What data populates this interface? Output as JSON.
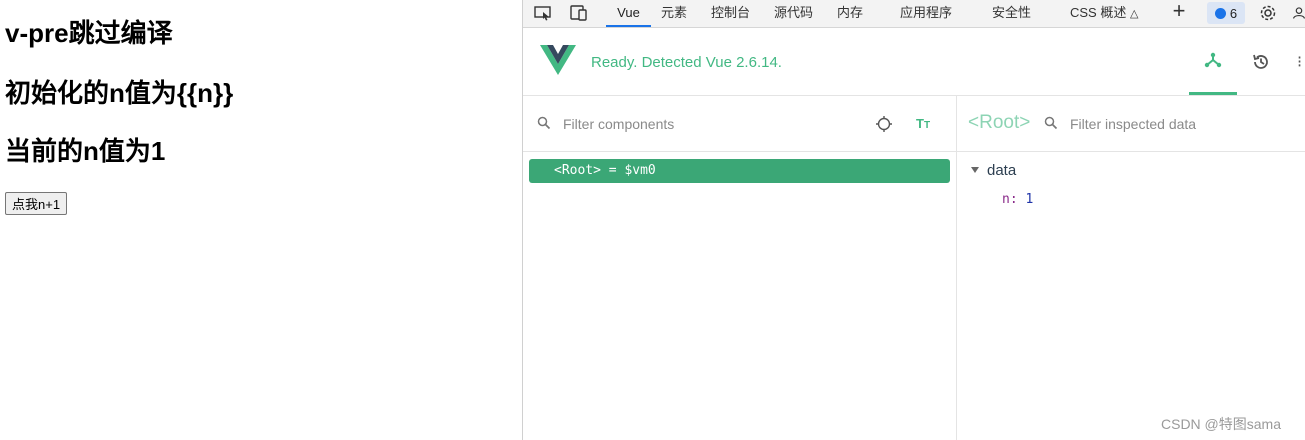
{
  "page": {
    "heading1": "v-pre跳过编译",
    "heading2": "初始化的n值为{{n}}",
    "heading3": "当前的n值为1",
    "button_label": "点我n+1"
  },
  "devtools": {
    "tabs": [
      "Vue",
      "元素",
      "控制台",
      "源代码",
      "内存",
      "应用程序",
      "安全性",
      "CSS 概述"
    ],
    "active_tab": "Vue",
    "issues_count": "6",
    "icons": [
      "inspect-icon",
      "device-toolbar-icon",
      "flask-icon",
      "plus-icon",
      "settings-icon",
      "user-icon"
    ]
  },
  "vue": {
    "status": "Ready. Detected Vue 2.6.14.",
    "accent_color": "#42b883",
    "components_filter_placeholder": "Filter components",
    "inspected_filter_placeholder": "Filter inspected data",
    "selected_component": "<Root>",
    "selected_component_var": "= $vm0",
    "inspected_title": "<Root>",
    "data_section": "data",
    "data_key": "n:",
    "data_value": "1"
  },
  "watermark": "CSDN @特图sama"
}
